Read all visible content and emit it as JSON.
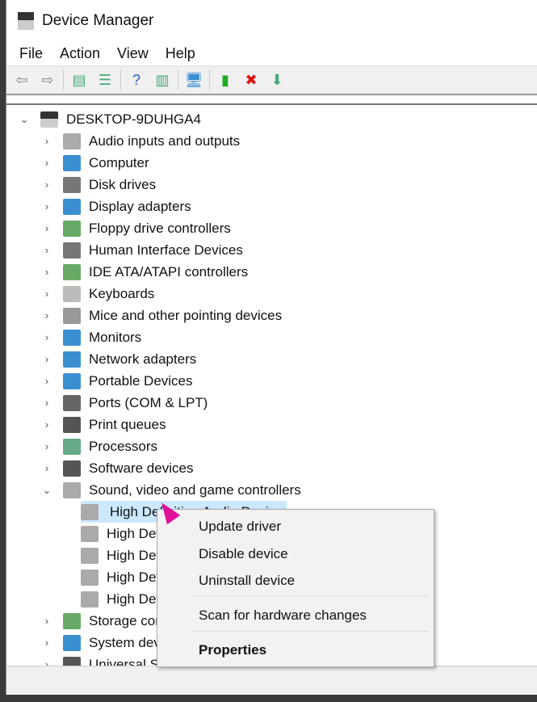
{
  "window": {
    "title": "Device Manager"
  },
  "menu": [
    "File",
    "Action",
    "View",
    "Help"
  ],
  "toolbar": [
    {
      "icon": "back-arrow-icon",
      "glyph": "⇦"
    },
    {
      "icon": "forward-arrow-icon",
      "glyph": "⇨"
    },
    {
      "icon": "show-hide-console-tree-icon",
      "glyph": "▤"
    },
    {
      "icon": "properties-icon",
      "glyph": "☰"
    },
    {
      "icon": "help-icon",
      "glyph": "?"
    },
    {
      "icon": "show-action-pane-icon",
      "glyph": "▥"
    },
    {
      "icon": "scan-hardware-icon",
      "glyph": "🖥"
    },
    {
      "icon": "update-driver-icon",
      "glyph": "▮"
    },
    {
      "icon": "uninstall-icon",
      "glyph": "✖"
    },
    {
      "icon": "download-icon",
      "glyph": "⬇"
    }
  ],
  "tree": {
    "root": "DESKTOP-9DUHGA4",
    "categories": [
      "Audio inputs and outputs",
      "Computer",
      "Disk drives",
      "Display adapters",
      "Floppy drive controllers",
      "Human Interface Devices",
      "IDE ATA/ATAPI controllers",
      "Keyboards",
      "Mice and other pointing devices",
      "Monitors",
      "Network adapters",
      "Portable Devices",
      "Ports (COM & LPT)",
      "Print queues",
      "Processors",
      "Software devices",
      "Sound, video and game controllers"
    ],
    "sound_children": [
      "High Definition Audio Device",
      "High Definition Audio Device",
      "High Definition Audio Device",
      "High Definition Audio Device",
      "High Definition Audio Device"
    ],
    "after": [
      "Storage controllers",
      "System devices",
      "Universal Serial Bus controllers"
    ]
  },
  "context_menu": {
    "update": "Update driver",
    "disable": "Disable device",
    "uninstall": "Uninstall device",
    "scan": "Scan for hardware changes",
    "properties": "Properties"
  }
}
